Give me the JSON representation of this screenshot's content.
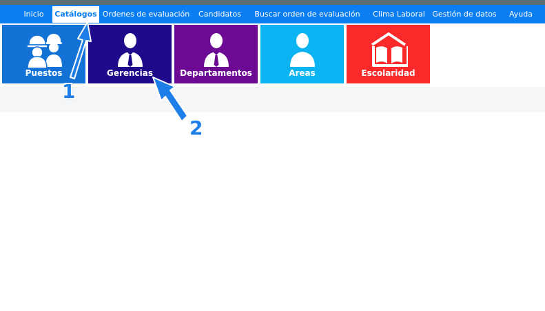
{
  "nav": {
    "items": [
      {
        "label": "Inicio",
        "active": false
      },
      {
        "label": "Catálogos",
        "active": true
      },
      {
        "label": "Ordenes de evaluación",
        "active": false
      },
      {
        "label": "Candidatos",
        "active": false
      },
      {
        "label": "Buscar orden de evaluación",
        "active": false
      },
      {
        "label": "Clima Laboral",
        "active": false
      },
      {
        "label": "Gestión de datos",
        "active": false
      },
      {
        "label": "Ayuda",
        "active": false
      }
    ]
  },
  "tiles": [
    {
      "label": "Puestos",
      "color": "#1272d6",
      "icon": "workers-icon"
    },
    {
      "label": "Gerencias",
      "color": "#1f0a8c",
      "icon": "manager-icon"
    },
    {
      "label": "Departamentos",
      "color": "#6c0a93",
      "icon": "manager-icon"
    },
    {
      "label": "Areas",
      "color": "#0ab3f2",
      "icon": "person-icon"
    },
    {
      "label": "Escolaridad",
      "color": "#fa2a2a",
      "icon": "book-icon"
    }
  ],
  "annotations": {
    "arrow1_label": "1",
    "arrow2_label": "2"
  }
}
